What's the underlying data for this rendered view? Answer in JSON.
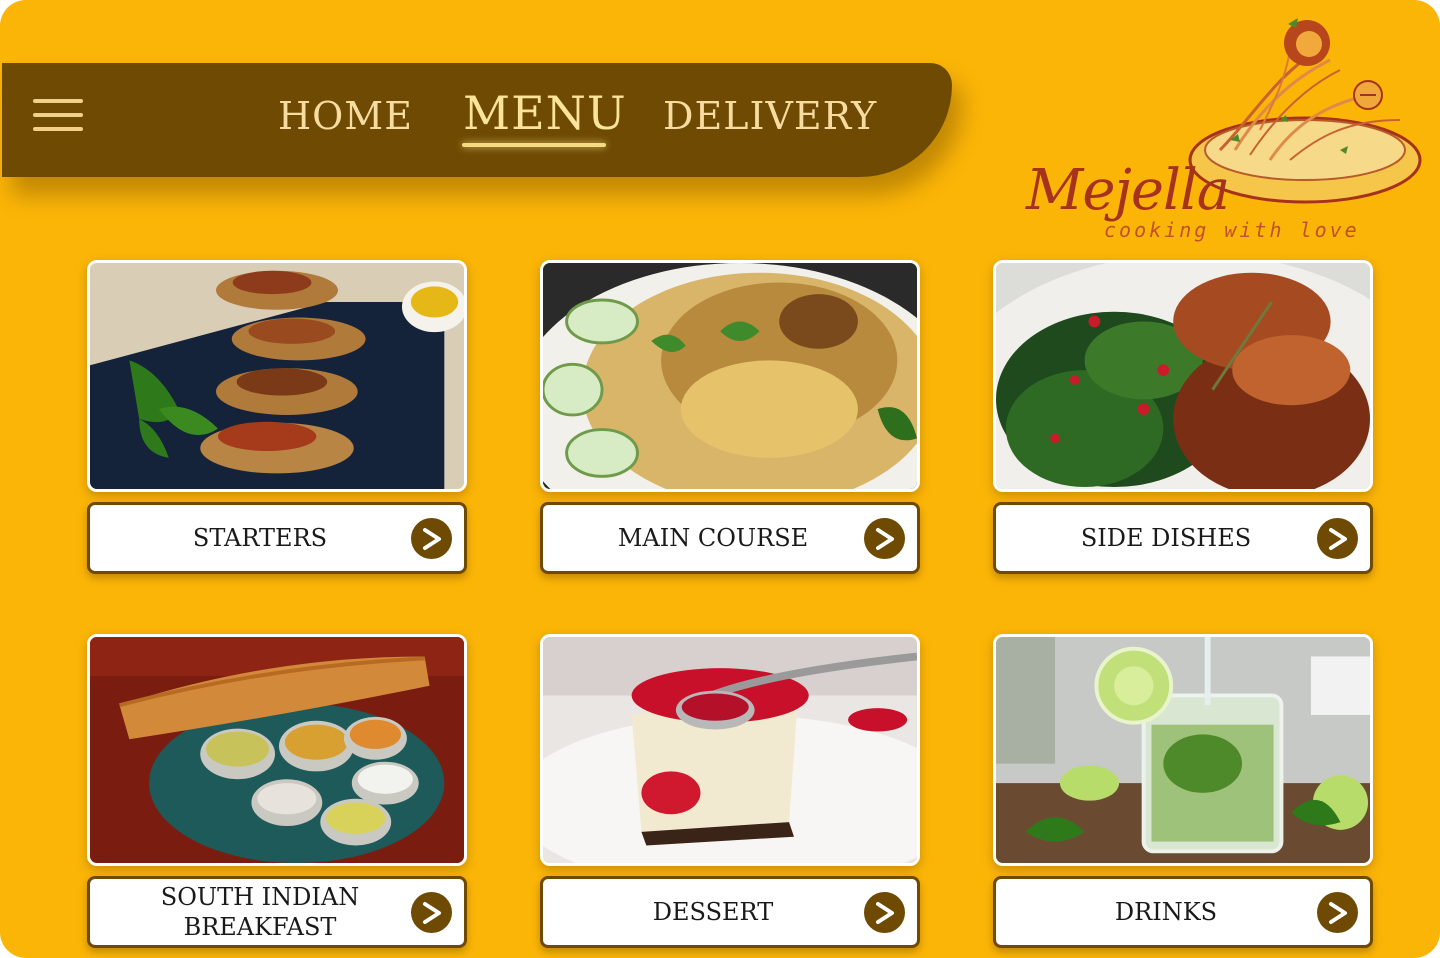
{
  "nav": {
    "items": [
      "HOME",
      "MENU",
      "DELIVERY"
    ],
    "active": "MENU"
  },
  "logo": {
    "name": "Mejella",
    "tagline": "cooking with love"
  },
  "colors": {
    "background": "#fbb507",
    "navbar": "#6e4a02",
    "nav_text": "#f6dca0",
    "accent": "#6e4a02"
  },
  "categories": [
    {
      "label": "STARTERS",
      "image": "bruschetta-photo",
      "icon": "arrow-right-icon"
    },
    {
      "label": "MAIN COURSE",
      "image": "biryani-photo",
      "icon": "arrow-right-icon"
    },
    {
      "label": "SIDE DISHES",
      "image": "grilled-chicken-salad-photo",
      "icon": "arrow-right-icon"
    },
    {
      "label": "SOUTH INDIAN\nBREAKFAST",
      "image": "dosa-thali-photo",
      "icon": "arrow-right-icon"
    },
    {
      "label": "DESSERT",
      "image": "cheesecake-photo",
      "icon": "arrow-right-icon"
    },
    {
      "label": "DRINKS",
      "image": "mojito-photo",
      "icon": "arrow-right-icon"
    }
  ]
}
